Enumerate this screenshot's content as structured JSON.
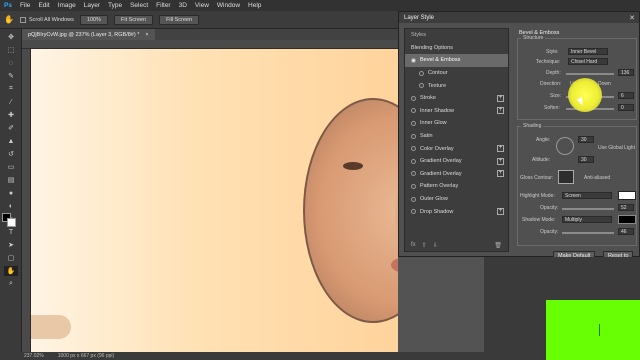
{
  "menu": [
    "File",
    "Edit",
    "Image",
    "Layer",
    "Type",
    "Select",
    "Filter",
    "3D",
    "View",
    "Window",
    "Help"
  ],
  "options": {
    "scroll_all": "Scroll All Windows",
    "zoom": "100%",
    "fit": "Fit Screen",
    "fill": "Fill Screen"
  },
  "document": {
    "tab": "pQjBIryCvW.jpg @ 237% (Layer 3, RGB/8#) *",
    "close": "×"
  },
  "status": {
    "zoom": "237.02%",
    "size": "1000 px x 667 px (96 ppi)"
  },
  "dialog": {
    "title": "Layer Style",
    "styles_header": "Styles",
    "blending": "Blending Options",
    "items": [
      {
        "label": "Bevel & Emboss",
        "checked": true,
        "active": true,
        "plus": false
      },
      {
        "label": "Contour",
        "checked": false,
        "active": false,
        "plus": false,
        "sub": true
      },
      {
        "label": "Texture",
        "checked": false,
        "active": false,
        "plus": false,
        "sub": true
      },
      {
        "label": "Stroke",
        "checked": false,
        "plus": true
      },
      {
        "label": "Inner Shadow",
        "checked": false,
        "plus": true
      },
      {
        "label": "Inner Glow",
        "checked": false,
        "plus": false
      },
      {
        "label": "Satin",
        "checked": false,
        "plus": false
      },
      {
        "label": "Color Overlay",
        "checked": false,
        "plus": true
      },
      {
        "label": "Gradient Overlay",
        "checked": false,
        "plus": true
      },
      {
        "label": "Gradient Overlay",
        "checked": false,
        "plus": true
      },
      {
        "label": "Pattern Overlay",
        "checked": false,
        "plus": false
      },
      {
        "label": "Outer Glow",
        "checked": false,
        "plus": false
      },
      {
        "label": "Drop Shadow",
        "checked": false,
        "plus": true
      }
    ],
    "fx": "fx",
    "panel": {
      "section": "Bevel & Emboss",
      "structure": "Structure",
      "style_label": "Style:",
      "style_value": "Inner Bevel",
      "technique_label": "Technique:",
      "technique_value": "Chisel Hard",
      "depth_label": "Depth:",
      "depth_value": "136",
      "direction_label": "Direction:",
      "dir_up": "Up",
      "dir_down": "Down",
      "size_label": "Size:",
      "size_value": "6",
      "soften_label": "Soften:",
      "soften_value": "0",
      "shading": "Shading",
      "angle_label": "Angle:",
      "angle_value": "30",
      "global_light": "Use Global Light",
      "altitude_label": "Altitude:",
      "altitude_value": "30",
      "gloss_label": "Gloss Contour:",
      "anti_alias": "Anti-aliased",
      "highlight_label": "Highlight Mode:",
      "highlight_value": "Screen",
      "hl_opacity_label": "Opacity:",
      "hl_opacity_value": "52",
      "shadow_label": "Shadow Mode:",
      "shadow_value": "Multiply",
      "sh_opacity_label": "Opacity:",
      "sh_opacity_value": "46",
      "make_default": "Make Default",
      "reset_default": "Reset to"
    }
  },
  "colors": {
    "accent_highlight": "#eeee33",
    "green_screen": "#68ff05"
  }
}
